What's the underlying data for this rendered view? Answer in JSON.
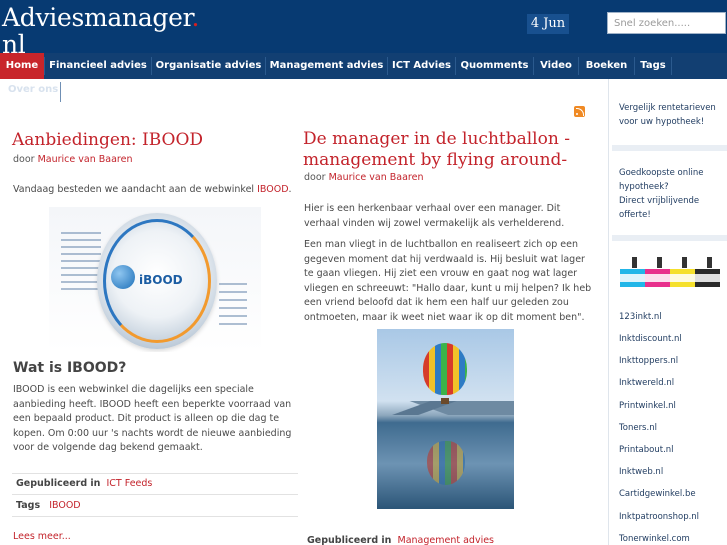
{
  "header": {
    "logo_main": "Adviesmanager",
    "logo_dot": ".",
    "logo_tld": "nl",
    "date": "4 Jun",
    "search_placeholder": "Snel zoeken....."
  },
  "nav": {
    "items": [
      {
        "label": "Home",
        "active": true
      },
      {
        "label": "Financieel advies"
      },
      {
        "label": "Organisatie advies"
      },
      {
        "label": "Management advies"
      },
      {
        "label": "ICT Advies"
      },
      {
        "label": "Quomments"
      },
      {
        "label": "Video"
      },
      {
        "label": "Boeken"
      },
      {
        "label": "Tags"
      }
    ],
    "overflow_item": "Over ons"
  },
  "post1": {
    "title": "Aanbiedingen: IBOOD",
    "by": "door",
    "author": "Maurice van Baaren",
    "intro_text": "Vandaag besteden we aandacht aan de webwinkel",
    "intro_link": "IBOOD",
    "intro_end": ".",
    "subheading": "Wat is IBOOD?",
    "body": "IBOOD is een webwinkel die dagelijks een speciale aanbieding heeft. IBOOD heeft een beperkte voorraad van een bepaald product. Dit product is alleen op die dag te kopen. Om 0:00 uur 's nachts wordt de nieuwe aanbieding voor de volgende dag bekend gemaakt.",
    "published_label": "Gepubliceerd in",
    "published_link": "ICT Feeds",
    "tags_label": "Tags",
    "tags_link": "IBOOD",
    "read_more": "Lees meer..."
  },
  "post2": {
    "title_line1": "De manager in de luchtballon -",
    "title_line2": "management by flying around-",
    "by": "door",
    "author": "Maurice van Baaren",
    "para1": "Hier is een herkenbaar verhaal over een manager. Dit verhaal vinden wij zowel vermakelijk als verhelderend.",
    "para2": "Een man vliegt in de luchtballon en realiseert zich op een gegeven moment dat hij verdwaald is. Hij besluit wat lager te gaan vliegen. Hij ziet een vrouw en gaat nog wat lager vliegen en schreeuwt: \"Hallo daar, kunt u mij helpen? Ik heb een vriend beloofd dat ik hem een half uur geleden zou ontmoeten, maar ik weet niet waar ik op dit moment ben\".",
    "published_label": "Gepubliceerd in",
    "published_link": "Management advies"
  },
  "sidebar": {
    "promo1": "Vergelijk rentetarieven voor uw hypotheek!",
    "promo2_a": "Goedkoopste online hypotheek?",
    "promo2_b": "Direct vrijblijvende offerte!",
    "links": [
      "123inkt.nl",
      "Inktdiscount.nl",
      "Inkttoppers.nl",
      "Inktwereld.nl",
      "Printwinkel.nl",
      "Toners.nl",
      "Printabout.nl",
      "Inktweb.nl",
      "Cartidgewinkel.be",
      "Inktpatroonshop.nl",
      "Tonerwinkel.com"
    ]
  },
  "icons": {
    "rss": "rss-icon"
  },
  "colors": {
    "header_bg": "#073a72",
    "nav_bg": "#123f72",
    "accent_red": "#c8252b",
    "link_red": "#c3232b"
  }
}
